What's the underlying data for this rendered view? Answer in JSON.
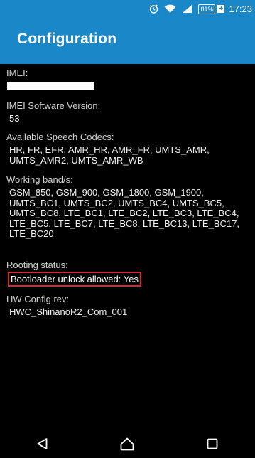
{
  "status_bar": {
    "battery_percent": "81%",
    "time": "17:23",
    "icons": [
      "alarm-icon",
      "wifi-icon",
      "signal-icon",
      "battery-icon"
    ]
  },
  "app_bar": {
    "title": "Configuration"
  },
  "fields": {
    "imei": {
      "label": "IMEI:"
    },
    "imei_sv": {
      "label": "IMEI Software Version:",
      "value": "53"
    },
    "codecs": {
      "label": "Available Speech Codecs:",
      "value": "HR, FR, EFR, AMR_HR, AMR_FR, UMTS_AMR, UMTS_AMR2, UMTS_AMR_WB"
    },
    "bands": {
      "label": "Working band/s:",
      "value": "GSM_850, GSM_900, GSM_1800, GSM_1900, UMTS_BC1, UMTS_BC2, UMTS_BC4, UMTS_BC5, UMTS_BC8, LTE_BC1, LTE_BC2, LTE_BC3, LTE_BC4, LTE_BC5, LTE_BC7, LTE_BC8, LTE_BC13, LTE_BC17, LTE_BC20"
    },
    "rooting": {
      "label": "Rooting status:",
      "value": "Bootloader unlock allowed: Yes"
    },
    "hw_config": {
      "label": "HW Config rev:",
      "value": "HWC_ShinanoR2_Com_001"
    }
  },
  "colors": {
    "accent": "#1a87c8",
    "highlight_border": "#d32a36",
    "background": "#000000",
    "text": "#ffffff"
  },
  "nav_bar": {
    "buttons": [
      "back-icon",
      "home-icon",
      "recents-icon"
    ]
  }
}
